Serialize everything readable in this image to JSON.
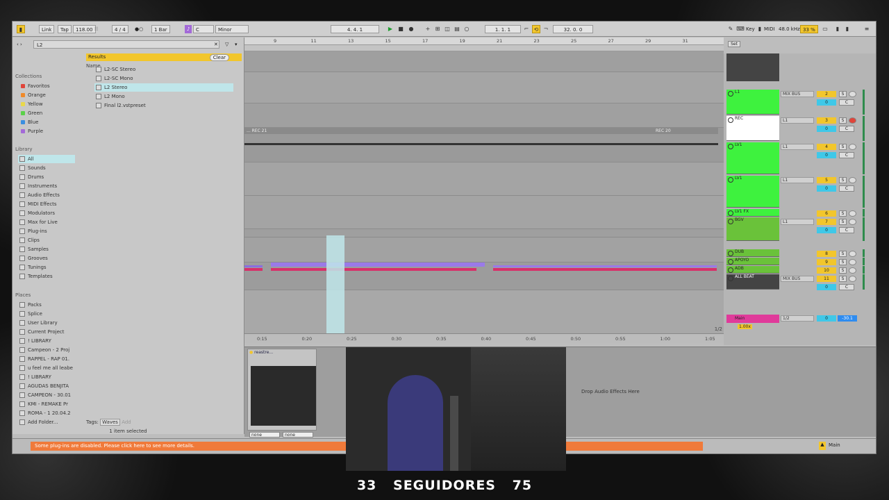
{
  "control_bar": {
    "link": "Link",
    "tap": "Tap",
    "tempo": "118.00",
    "meter": "4 / 4",
    "quant": "1 Bar",
    "key": "C",
    "scale": "Minor",
    "position": "4.   4.   1",
    "loop_start": "1.   1.   1",
    "loop_len": "32.   0.   0",
    "key_btn": "Key",
    "midi_btn": "MIDI",
    "sample_rate": "48.0 kHz",
    "cpu": "33 %"
  },
  "browser": {
    "search": "L2",
    "collections_header": "Collections",
    "collections": [
      {
        "label": "Favoritos",
        "color": "#e0443a"
      },
      {
        "label": "Orange",
        "color": "#f08a2a"
      },
      {
        "label": "Yellow",
        "color": "#e9d84a"
      },
      {
        "label": "Green",
        "color": "#5bd14a"
      },
      {
        "label": "Blue",
        "color": "#3a8fe0"
      },
      {
        "label": "Purple",
        "color": "#a36ad8"
      }
    ],
    "library_header": "Library",
    "library": [
      "All",
      "Sounds",
      "Drums",
      "Instruments",
      "Audio Effects",
      "MIDI Effects",
      "Modulators",
      "Max for Live",
      "Plug-ins",
      "Clips",
      "Samples",
      "Grooves",
      "Tunings",
      "Templates"
    ],
    "places_header": "Places",
    "places": [
      "Packs",
      "Splice",
      "User Library",
      "Current Project",
      "! LIBRARY",
      "Campeon - 2 Proj",
      "RAPPEL - RAP 01.",
      "u feel me all leabe",
      "! LIBRARY",
      "AGUDAS BENJITA",
      "CAMPEON - 30.01",
      "KMI - REMAKE Pr",
      "ROMA - 1 20.04.2",
      "Add Folder..."
    ],
    "results_label": "Results",
    "clear_label": "Clear",
    "name_col": "Name",
    "results": [
      "L2-SC Stereo",
      "L2-SC Mono",
      "L2 Stereo",
      "L2 Mono",
      "Final l2.vstpreset"
    ],
    "tags_label": "Tags:",
    "tag": "Waves",
    "add_label": "Add",
    "status": "1 item selected"
  },
  "arrangement": {
    "bars": [
      "9",
      "11",
      "13",
      "15",
      "17",
      "19",
      "21",
      "23",
      "25",
      "27",
      "29",
      "31"
    ],
    "clip_left": "... REC 21",
    "clip_right": "REC 20",
    "times": [
      "0:15",
      "0:20",
      "0:25",
      "0:30",
      "0:35",
      "0:40",
      "0:45",
      "0:50",
      "0:55",
      "1:00",
      "1:05"
    ],
    "zoom": "1/2"
  },
  "mixer": {
    "set_label": "Set",
    "tracks": [
      {
        "name": "L1",
        "io": "MIX BUS",
        "num": "2",
        "color": "#3ef23e"
      },
      {
        "name": "REC",
        "io": "L1",
        "num": "3",
        "color": "#ffffff"
      },
      {
        "name": "LV1",
        "io": "L1",
        "num": "4",
        "color": "#3ef23e"
      },
      {
        "name": "LV1",
        "io": "L1",
        "num": "5",
        "color": "#3ef23e"
      },
      {
        "name": "LV1 FX",
        "io": "",
        "num": "6",
        "color": "#3ef23e"
      },
      {
        "name": "BGV",
        "io": "L1",
        "num": "7",
        "color": "#6ac23a"
      },
      {
        "name": "DUB",
        "io": "",
        "num": "8",
        "color": "#6ac23a"
      },
      {
        "name": "APOYO",
        "io": "",
        "num": "9",
        "color": "#6ac23a"
      },
      {
        "name": "ADB",
        "io": "",
        "num": "10",
        "color": "#6ac23a"
      },
      {
        "name": "ALL BEAT",
        "io": "MIX BUS",
        "num": "11",
        "color": "#444444"
      }
    ],
    "main_name": "Main",
    "main_io": "1/2",
    "main_vol": "-30.1",
    "ratio": "1.00x",
    "auto": "Auto",
    "off": "Off",
    "in": "In",
    "s": "S",
    "c": "C",
    "zero": "0"
  },
  "device": {
    "name": "reastre...",
    "drop_text": "Drop Audio Effects Here",
    "none1": "none",
    "none2": "none"
  },
  "status_bar": {
    "message": "Some plug-ins are disabled. Please click here to see more details.",
    "main": "Main"
  },
  "overlay": {
    "text": "33  SEGUIDORES  75"
  }
}
